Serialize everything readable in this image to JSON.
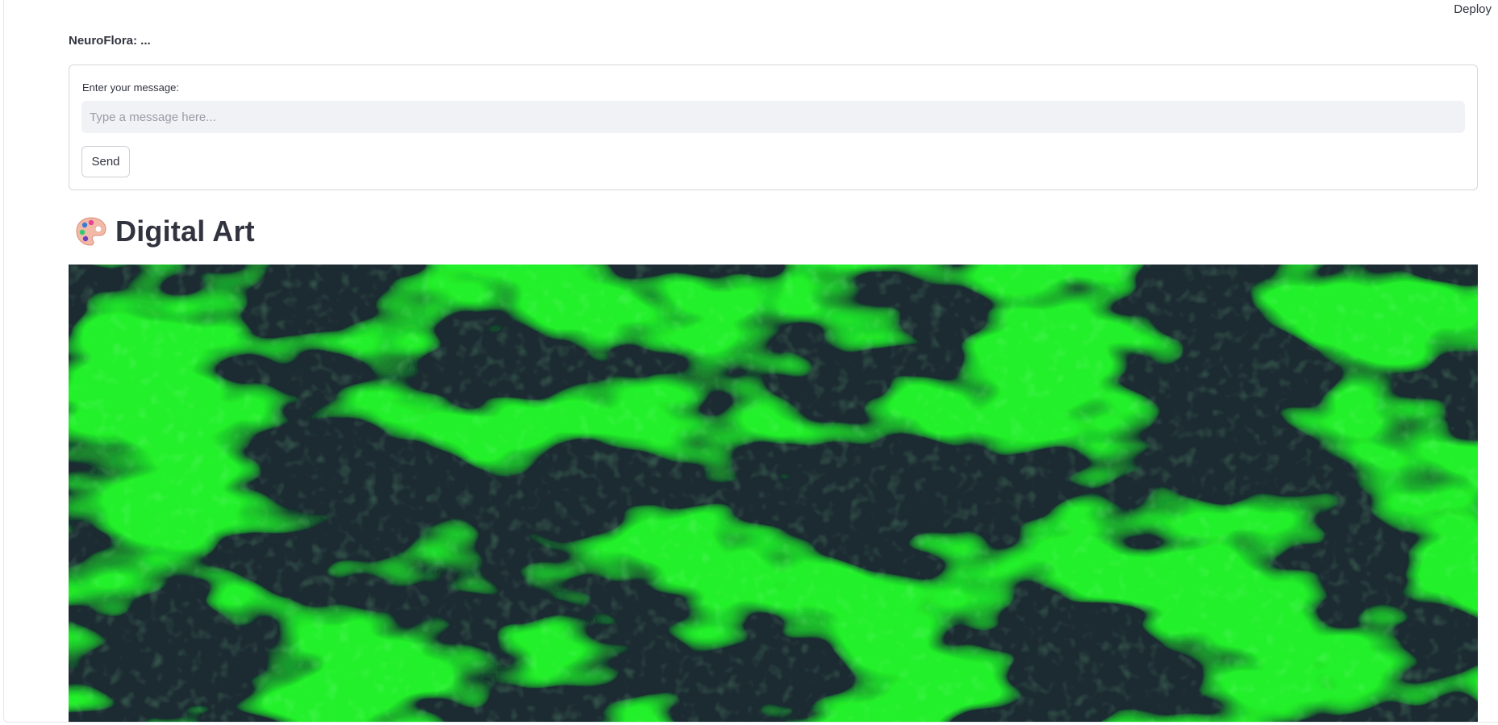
{
  "header": {
    "deploy_label": "Deploy"
  },
  "status": {
    "text": "NeuroFlora: ..."
  },
  "chat_form": {
    "label": "Enter your message:",
    "input_value": "",
    "input_placeholder": "Type a message here...",
    "send_label": "Send"
  },
  "art_section": {
    "title": "Digital Art",
    "icon": "artist-palette-icon",
    "image": {
      "description_colors": {
        "foreground": "#22f02a",
        "background": "#1c2a33"
      }
    }
  },
  "colors": {
    "text": "#31333f",
    "input_bg": "#f0f2f6",
    "border": "#d6d6dc"
  }
}
